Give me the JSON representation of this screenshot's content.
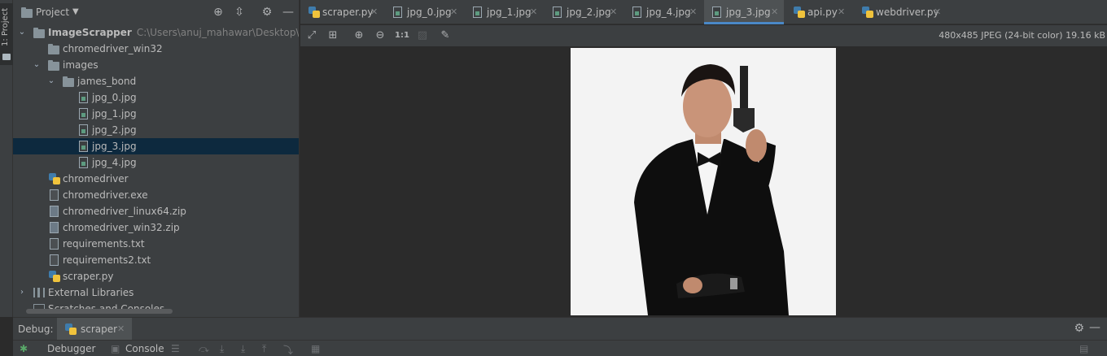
{
  "side_tab": {
    "label": "1: Project"
  },
  "project_panel": {
    "title": "Project",
    "tree": [
      {
        "label": "ImageScrapper",
        "hint": "C:\\Users\\anuj_mahawar\\Desktop\\Python",
        "icon": "folder-icon"
      },
      {
        "label": "chromedriver_win32",
        "icon": "folder-icon"
      },
      {
        "label": "images",
        "icon": "folder-icon"
      },
      {
        "label": "james_bond",
        "icon": "folder-icon"
      },
      {
        "label": "jpg_0.jpg",
        "icon": "image-file-icon"
      },
      {
        "label": "jpg_1.jpg",
        "icon": "image-file-icon"
      },
      {
        "label": "jpg_2.jpg",
        "icon": "image-file-icon"
      },
      {
        "label": "jpg_3.jpg",
        "icon": "image-file-icon"
      },
      {
        "label": "jpg_4.jpg",
        "icon": "image-file-icon"
      },
      {
        "label": "chromedriver",
        "icon": "python-file-icon"
      },
      {
        "label": "chromedriver.exe",
        "icon": "text-file-icon"
      },
      {
        "label": "chromedriver_linux64.zip",
        "icon": "zip-file-icon"
      },
      {
        "label": "chromedriver_win32.zip",
        "icon": "zip-file-icon"
      },
      {
        "label": "requirements.txt",
        "icon": "text-file-icon"
      },
      {
        "label": "requirements2.txt",
        "icon": "text-file-icon"
      },
      {
        "label": "scraper.py",
        "icon": "python-file-icon"
      },
      {
        "label": "External Libraries",
        "icon": "library-icon"
      },
      {
        "label": "Scratches and Consoles",
        "icon": "scratch-icon"
      }
    ]
  },
  "tabs": [
    {
      "label": "scraper.py",
      "icon": "python-file-icon"
    },
    {
      "label": "jpg_0.jpg",
      "icon": "image-file-icon"
    },
    {
      "label": "jpg_1.jpg",
      "icon": "image-file-icon"
    },
    {
      "label": "jpg_2.jpg",
      "icon": "image-file-icon"
    },
    {
      "label": "jpg_4.jpg",
      "icon": "image-file-icon"
    },
    {
      "label": "jpg_3.jpg",
      "icon": "image-file-icon",
      "active": true
    },
    {
      "label": "api.py",
      "icon": "python-file-icon"
    },
    {
      "label": "webdriver.py",
      "icon": "python-file-icon"
    }
  ],
  "image_toolbar": {
    "zoom_actual_label": "1:1",
    "image_info": "480x485 JPEG (24-bit color) 19.16 kB"
  },
  "debug": {
    "label": "Debug:",
    "tab_label": "scraper",
    "debugger_label": "Debugger",
    "console_label": "Console"
  },
  "colors": {
    "selection": "#0d293e",
    "active_tab_underline": "#4a88c7",
    "panel_bg": "#3c3f41",
    "editor_bg": "#2b2b2b"
  }
}
